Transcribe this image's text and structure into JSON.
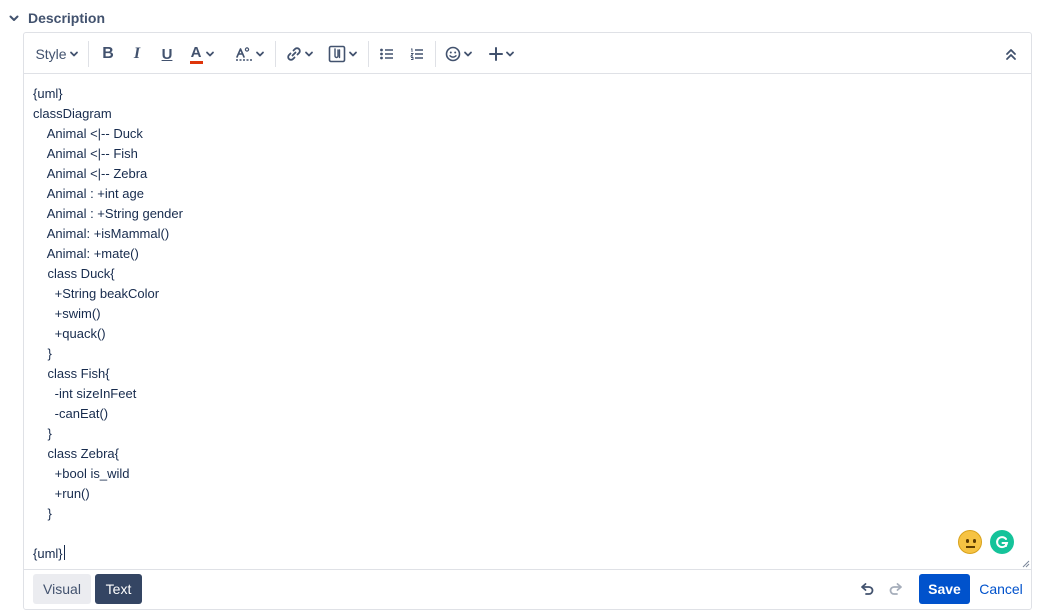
{
  "section": {
    "title": "Description"
  },
  "toolbar": {
    "style_label": "Style",
    "items": [
      {
        "name": "bold",
        "glyph": "B"
      },
      {
        "name": "italic",
        "glyph": "I"
      },
      {
        "name": "underline",
        "glyph": "U"
      },
      {
        "name": "text-color",
        "glyph": "A"
      }
    ],
    "colors": {
      "text_color_bar": "#de350b"
    }
  },
  "content": {
    "lines": [
      "{uml}",
      "classDiagram",
      "    Animal <|-- Duck",
      "    Animal <|-- Fish",
      "    Animal <|-- Zebra",
      "    Animal : +int age",
      "    Animal : +String gender",
      "    Animal: +isMammal()",
      "    Animal: +mate()",
      "    class Duck{",
      "      +String beakColor",
      "      +swim()",
      "      +quack()",
      "    }",
      "    class Fish{",
      "      -int sizeInFeet",
      "      -canEat()",
      "    }",
      "    class Zebra{",
      "      +bool is_wild",
      "      +run()",
      "    }",
      "",
      "{uml}"
    ]
  },
  "footer": {
    "visual_label": "Visual",
    "text_label": "Text",
    "save_label": "Save",
    "cancel_label": "Cancel"
  },
  "colors": {
    "primary": "#0052cc",
    "dark_button": "#344563",
    "grammarly": "#15c39a"
  }
}
